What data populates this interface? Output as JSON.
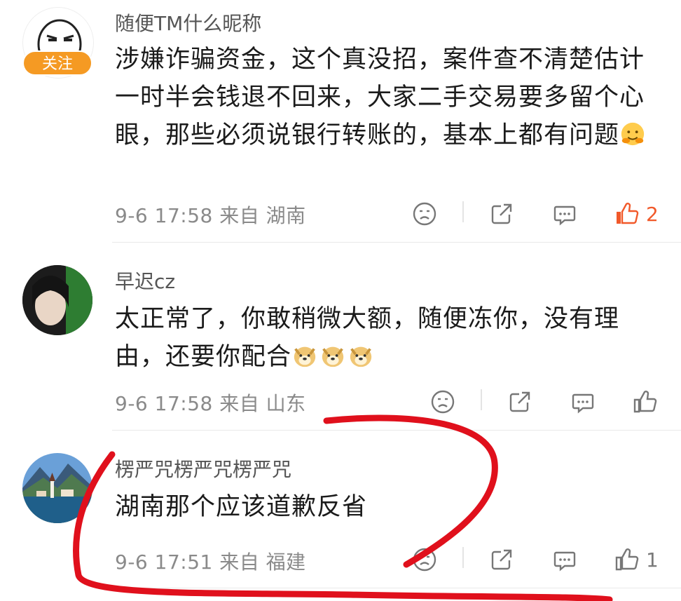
{
  "comments": [
    {
      "username": "随便TM什么昵称",
      "follow_label": "关注",
      "text": "涉嫌诈骗资金，这个真没招，案件查不清楚估计一时半会钱退不回来，大家二手交易要多留个心眼，那些必须说银行转账的，基本上都有问题",
      "emoji": "hug-emoji",
      "meta": "9-6 17:58 来自 湖南",
      "like_count": "2",
      "liked": true
    },
    {
      "username": "早迟cz",
      "text": "太正常了，你敢稍微大额，随便冻你，没有理由，还要你配合",
      "emoji": "doge-emoji x3",
      "meta": "9-6 17:58 来自 山东",
      "like_count": "",
      "liked": false
    },
    {
      "username": "楞严咒楞严咒楞严咒",
      "text": "湖南那个应该道歉反省",
      "meta": "9-6 17:51 来自 福建",
      "like_count": "1",
      "liked": false
    }
  ],
  "colors": {
    "accent": "#f1592a",
    "follow_badge": "#f59a23",
    "annotation_red": "#e0101c"
  }
}
